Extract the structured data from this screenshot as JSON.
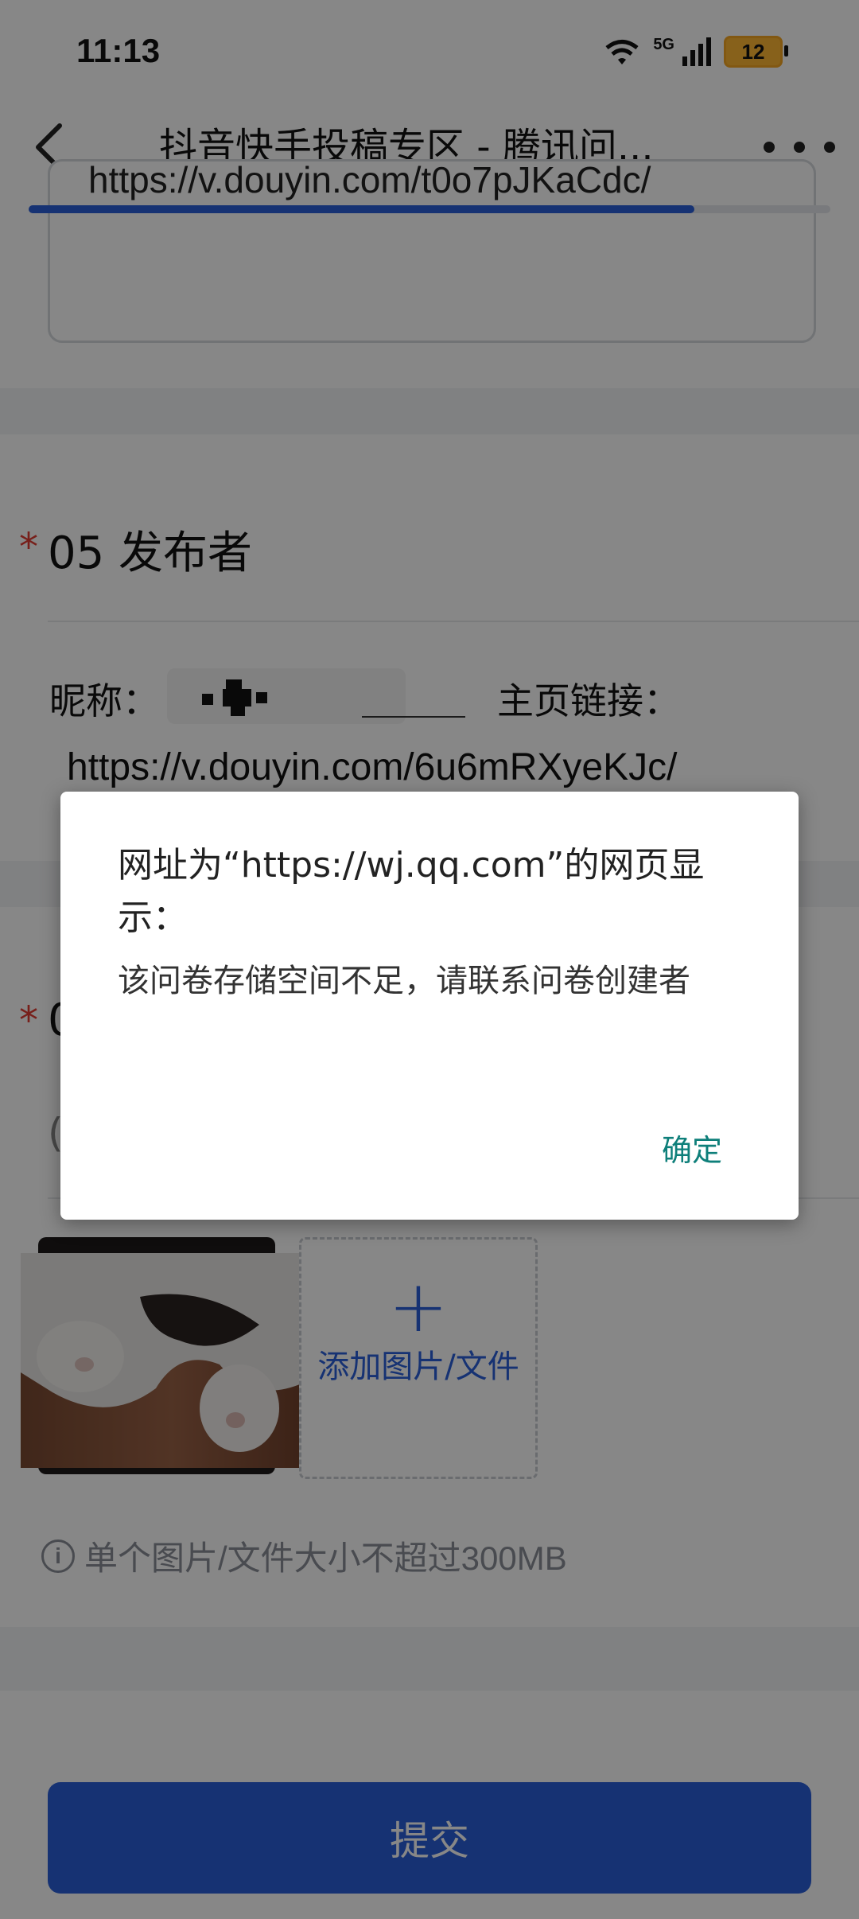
{
  "status_bar": {
    "time": "11:13",
    "network": "5G",
    "battery": "12",
    "battery_color": "#f5a623"
  },
  "nav": {
    "title": "抖音快手投稿专区 - 腾讯问...",
    "back_icon": "chevron-left-icon",
    "more_icon": "more-dots-icon",
    "progress": 0.83
  },
  "form": {
    "prev_answer_text": "https://v.douyin.com/t0o7pJKaCdc/",
    "q5": {
      "required_mark": "*",
      "title": "05 发布者"
    },
    "nickname_label": "昵称：",
    "homepage_label": "主页链接：",
    "homepage_url": "https://v.douyin.com/6u6mRXyeKJc/",
    "q6": {
      "required_mark": "*",
      "number": "0",
      "placeholder": "("
    },
    "add_file_plus": "+",
    "add_file_label": "添加图片/文件",
    "upload_hint": "单个图片/文件大小不超过300MB",
    "info_icon": "i",
    "submit_label": "提交"
  },
  "dialog": {
    "title": "网址为“https://wj.qq.com”的网页显示：",
    "message": "该问卷存储空间不足，请联系问卷创建者",
    "ok_label": "确定"
  },
  "colors": {
    "accent": "#2b5fd9",
    "required": "#e03c31",
    "dialog_button": "#0e7f7a"
  }
}
